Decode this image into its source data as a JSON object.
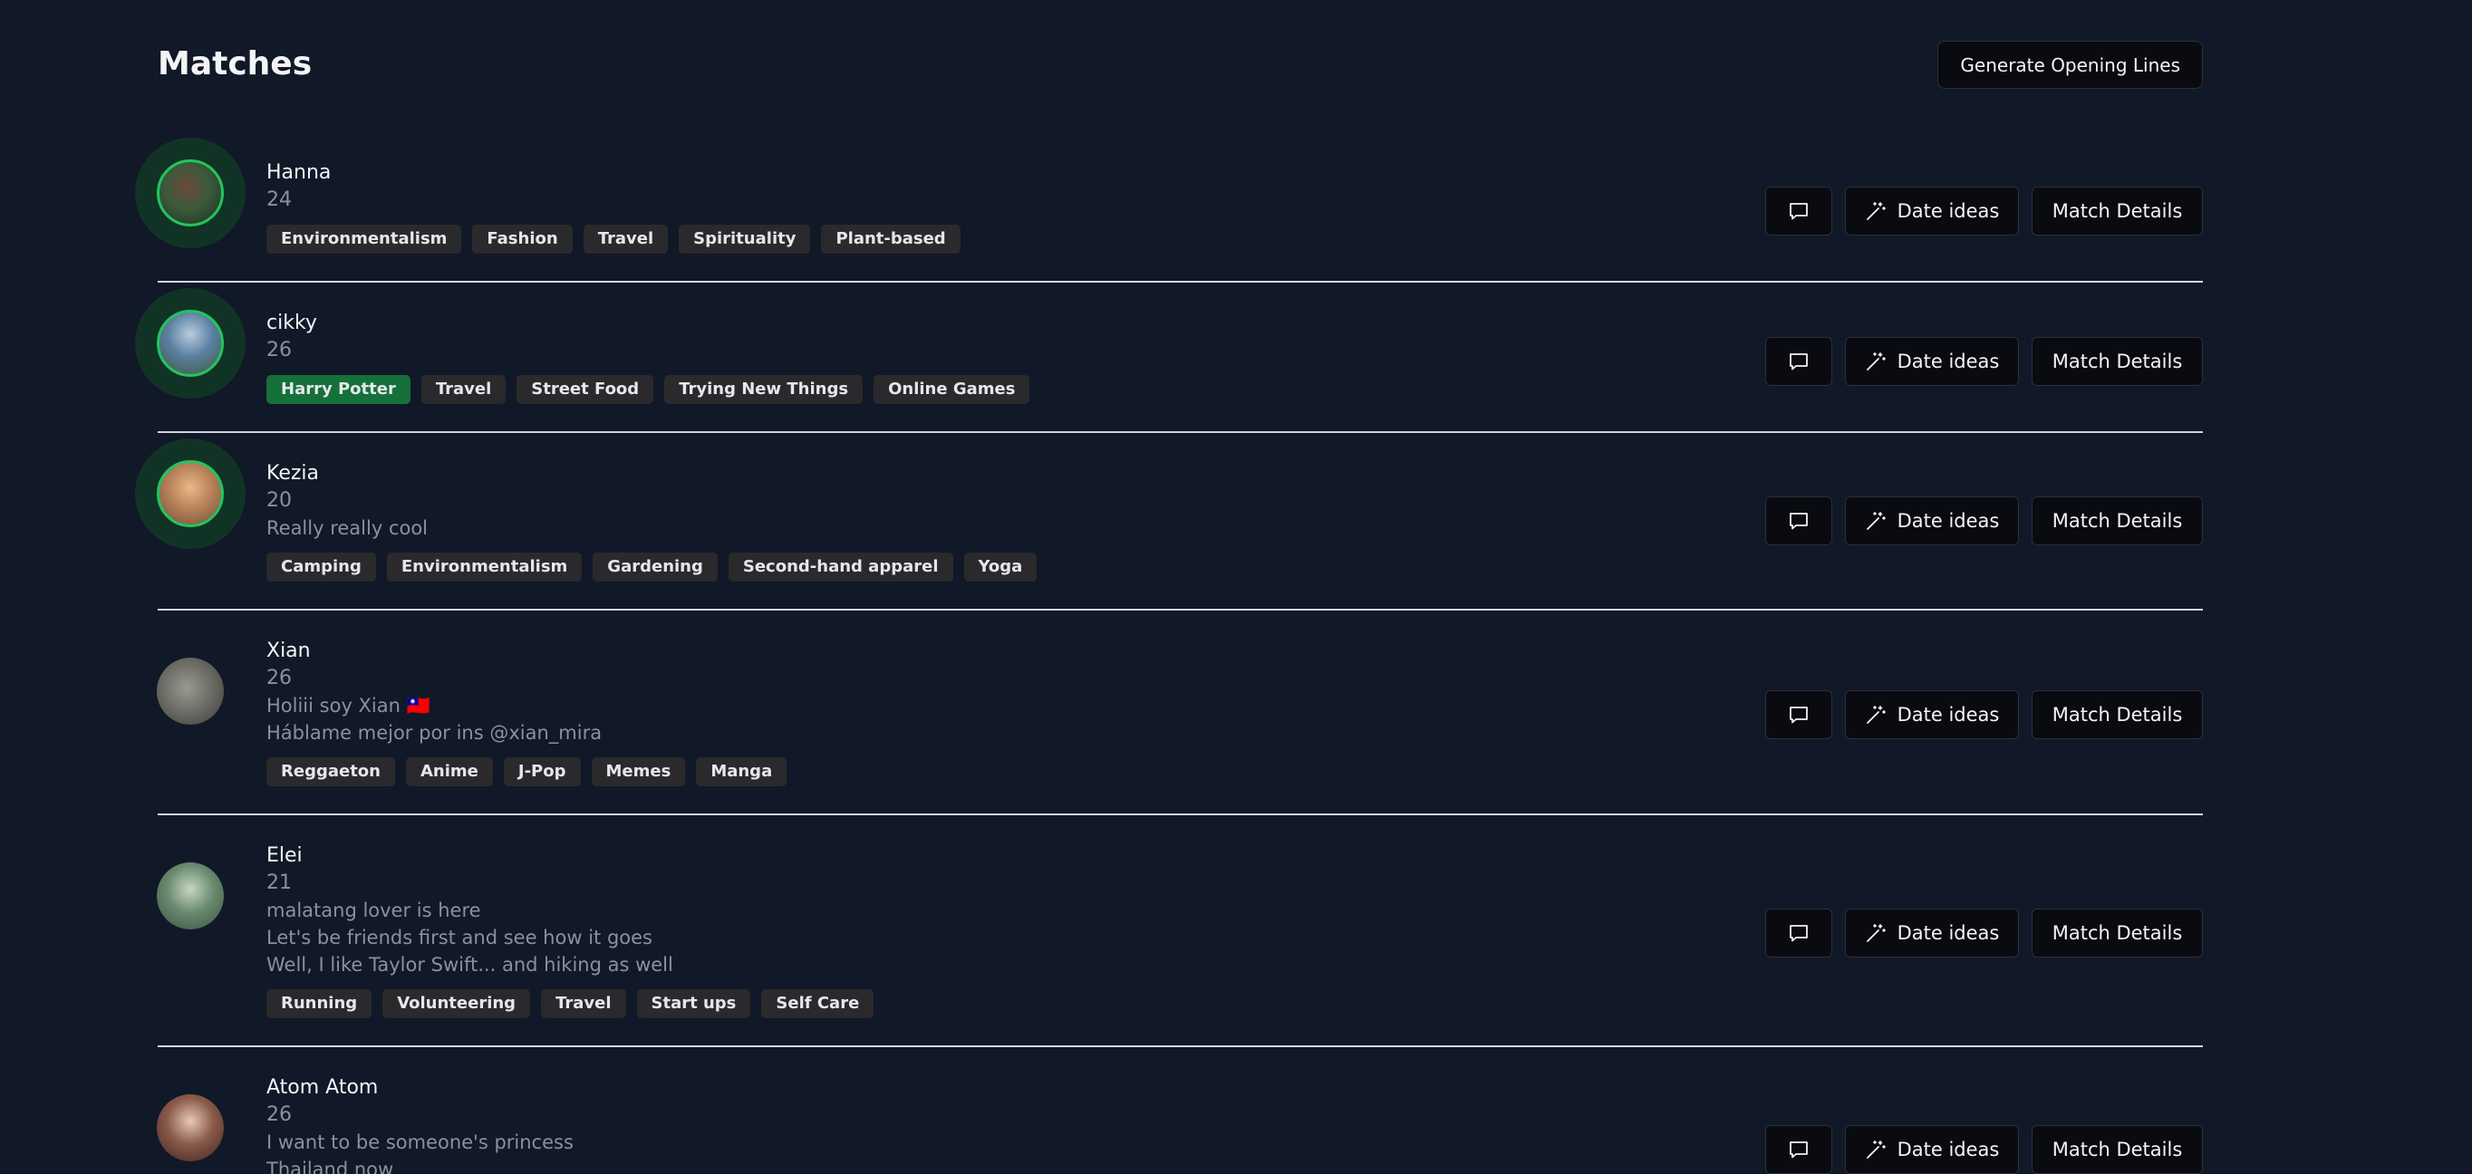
{
  "page": {
    "title": "Matches",
    "generate_label": "Generate Opening Lines"
  },
  "actions": {
    "date_ideas_label": "Date ideas",
    "match_details_label": "Match Details"
  },
  "colors": {
    "background": "#111827",
    "highlight_tag": "#15703a",
    "avatar_ring": "#22c55e",
    "avatar_halo": "#113326"
  },
  "icons": {
    "chat": "message-square-icon",
    "date_ideas": "magic-wand-icon"
  },
  "matches": [
    {
      "name": "Hanna",
      "age": "24",
      "bio": [],
      "tags": [
        "Environmentalism",
        "Fashion",
        "Travel",
        "Spirituality",
        "Plant-based"
      ],
      "highlighted_tags": [],
      "new_match": true
    },
    {
      "name": "cikky",
      "age": "26",
      "bio": [],
      "tags": [
        "Harry Potter",
        "Travel",
        "Street Food",
        "Trying New Things",
        "Online Games"
      ],
      "highlighted_tags": [
        "Harry Potter"
      ],
      "new_match": true
    },
    {
      "name": "Kezia",
      "age": "20",
      "bio": [
        "Really really cool"
      ],
      "tags": [
        "Camping",
        "Environmentalism",
        "Gardening",
        "Second-hand apparel",
        "Yoga"
      ],
      "highlighted_tags": [],
      "new_match": true
    },
    {
      "name": "Xian",
      "age": "26",
      "bio": [
        "Holiii soy Xian 🇹🇼",
        "Háblame mejor por ins @xian_mira"
      ],
      "tags": [
        "Reggaeton",
        "Anime",
        "J-Pop",
        "Memes",
        "Manga"
      ],
      "highlighted_tags": [],
      "new_match": false
    },
    {
      "name": "Elei",
      "age": "21",
      "bio": [
        "malatang lover is here",
        "Let's be friends first and see how it goes",
        "Well, I like Taylor Swift... and hiking as well"
      ],
      "tags": [
        "Running",
        "Volunteering",
        "Travel",
        "Start ups",
        "Self Care"
      ],
      "highlighted_tags": [],
      "new_match": false
    },
    {
      "name": "Atom Atom",
      "age": "26",
      "bio": [
        "I want to be someone's princess",
        "Thailand now"
      ],
      "tags": [],
      "highlighted_tags": [],
      "new_match": false
    }
  ]
}
